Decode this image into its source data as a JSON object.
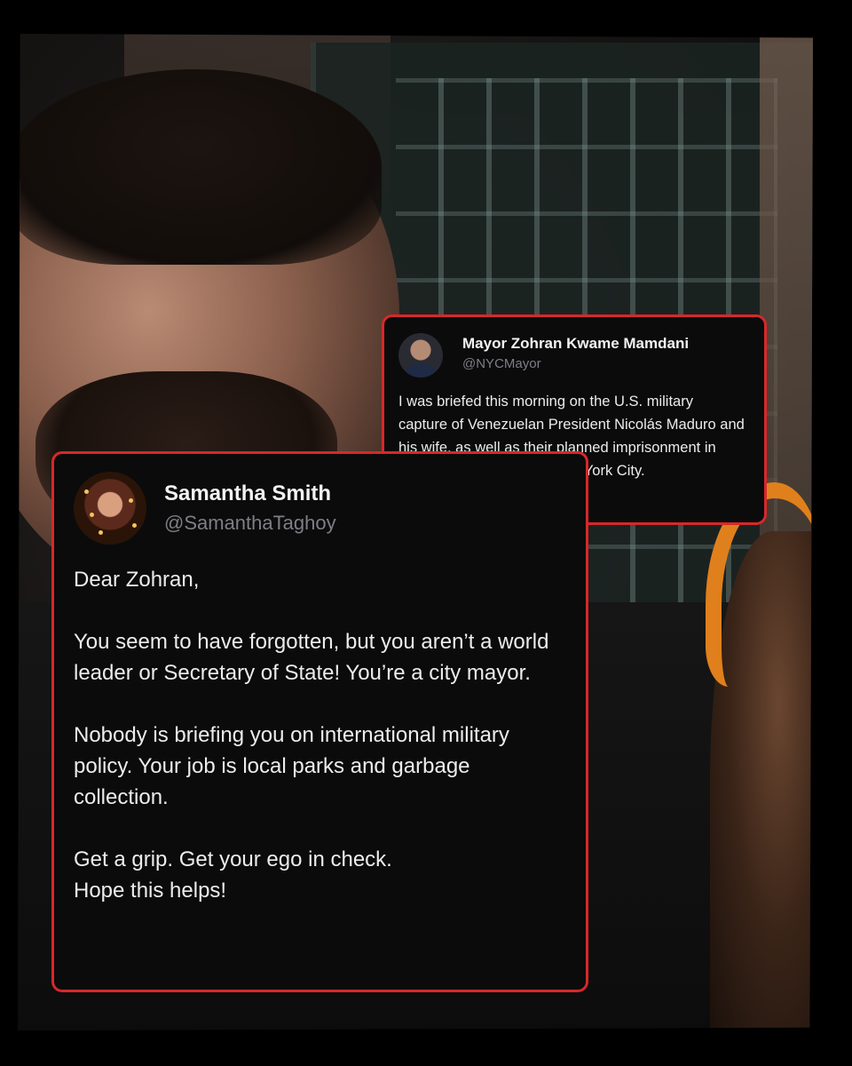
{
  "mamdani_tweet": {
    "display_name": "Mayor Zohran Kwame Mamdani",
    "handle": "@NYCMayor",
    "avatar_icon": "profile-photo-avatar",
    "body": "I was briefed this morning on the U.S. military capture of Venezuelan President Nicolás Maduro and his wife, as well as their planned imprisonment in federal custody here in New York City."
  },
  "smith_tweet": {
    "display_name": "Samantha Smith",
    "handle": "@SamanthaTaghoy",
    "avatar_icon": "profile-photo-avatar",
    "paragraphs": [
      "Dear Zohran,",
      "You seem to have forgotten, but you aren’t a world leader or Secretary of State! You’re a city mayor.",
      "Nobody is briefing you on international military policy. Your job is local parks and garbage collection.",
      "Get a grip. Get your ego in check."
    ],
    "closing": "Hope this helps!"
  },
  "colors": {
    "card_border": "#d7282a",
    "card_background": "#0b0b0c",
    "handle_gray": "#7e7e84",
    "headscarf_orange": "#e0801c"
  }
}
